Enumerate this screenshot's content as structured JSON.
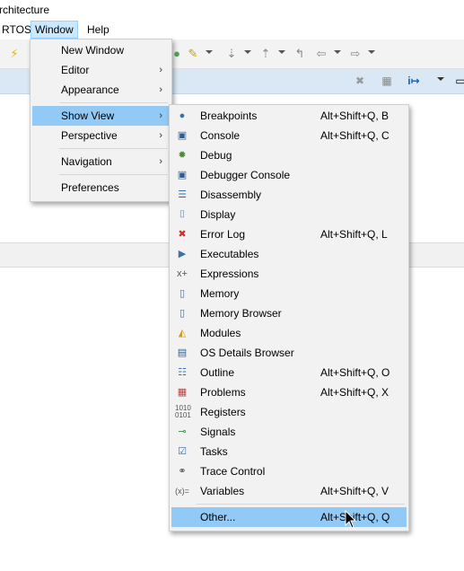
{
  "window": {
    "title_fragment": "rchitecture"
  },
  "menubar": {
    "items": [
      {
        "label": "RTOS"
      },
      {
        "label": "Window"
      },
      {
        "label": "Help"
      }
    ]
  },
  "window_menu": {
    "items": [
      {
        "label": "New Window"
      },
      {
        "label": "Editor"
      },
      {
        "label": "Appearance"
      },
      {
        "label": "Show View"
      },
      {
        "label": "Perspective"
      },
      {
        "label": "Navigation"
      },
      {
        "label": "Preferences"
      }
    ]
  },
  "show_view_menu": {
    "items": [
      {
        "label": "Breakpoints",
        "accel": "Alt+Shift+Q, B",
        "icon": "breakpoints-icon"
      },
      {
        "label": "Console",
        "accel": "Alt+Shift+Q, C",
        "icon": "console-icon"
      },
      {
        "label": "Debug",
        "accel": "",
        "icon": "debug-icon"
      },
      {
        "label": "Debugger Console",
        "accel": "",
        "icon": "debugger-console-icon"
      },
      {
        "label": "Disassembly",
        "accel": "",
        "icon": "disassembly-icon"
      },
      {
        "label": "Display",
        "accel": "",
        "icon": "display-icon"
      },
      {
        "label": "Error Log",
        "accel": "Alt+Shift+Q, L",
        "icon": "error-log-icon"
      },
      {
        "label": "Executables",
        "accel": "",
        "icon": "executables-icon"
      },
      {
        "label": "Expressions",
        "accel": "",
        "icon": "expressions-icon"
      },
      {
        "label": "Memory",
        "accel": "",
        "icon": "memory-icon"
      },
      {
        "label": "Memory Browser",
        "accel": "",
        "icon": "memory-browser-icon"
      },
      {
        "label": "Modules",
        "accel": "",
        "icon": "modules-icon"
      },
      {
        "label": "OS Details Browser",
        "accel": "",
        "icon": "os-details-icon"
      },
      {
        "label": "Outline",
        "accel": "Alt+Shift+Q, O",
        "icon": "outline-icon"
      },
      {
        "label": "Problems",
        "accel": "Alt+Shift+Q, X",
        "icon": "problems-icon"
      },
      {
        "label": "Registers",
        "accel": "",
        "icon": "registers-icon"
      },
      {
        "label": "Signals",
        "accel": "",
        "icon": "signals-icon"
      },
      {
        "label": "Tasks",
        "accel": "",
        "icon": "tasks-icon"
      },
      {
        "label": "Trace Control",
        "accel": "",
        "icon": "trace-control-icon"
      },
      {
        "label": "Variables",
        "accel": "Alt+Shift+Q, V",
        "icon": "variables-icon"
      },
      {
        "label": "Other...",
        "accel": "Alt+Shift+Q, Q",
        "icon": ""
      }
    ]
  },
  "colors": {
    "highlight": "#91c9f7",
    "menubar_active": "#cce8ff",
    "viewbar": "#dae8f5"
  }
}
